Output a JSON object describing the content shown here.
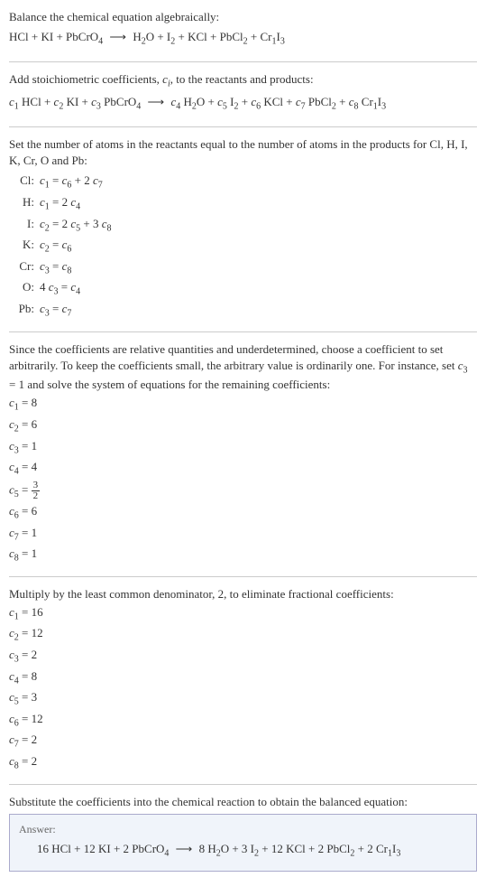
{
  "section1": {
    "intro": "Balance the chemical equation algebraically:",
    "equation_lhs": "HCl + KI + PbCrO",
    "equation_lhs_sub": "4",
    "arrow": "⟶",
    "equation_rhs": "H₂O + I₂ + KCl + PbCl₂ + Cr₁I₃"
  },
  "section2": {
    "intro_a": "Add stoichiometric coefficients, ",
    "ci": "c",
    "ci_sub": "i",
    "intro_b": ", to the reactants and products:",
    "eq": "c₁ HCl + c₂ KI + c₃ PbCrO₄  ⟶  c₄ H₂O + c₅ I₂ + c₆ KCl + c₇ PbCl₂ + c₈ Cr₁I₃"
  },
  "section3": {
    "intro": "Set the number of atoms in the reactants equal to the number of atoms in the products for Cl, H, I, K, Cr, O and Pb:",
    "rows": [
      {
        "label": "Cl:",
        "eq": "c₁ = c₆ + 2 c₇"
      },
      {
        "label": "H:",
        "eq": "c₁ = 2 c₄"
      },
      {
        "label": "I:",
        "eq": "c₂ = 2 c₅ + 3 c₈"
      },
      {
        "label": "K:",
        "eq": "c₂ = c₆"
      },
      {
        "label": "Cr:",
        "eq": "c₃ = c₈"
      },
      {
        "label": "O:",
        "eq": "4 c₃ = c₄"
      },
      {
        "label": "Pb:",
        "eq": "c₃ = c₇"
      }
    ]
  },
  "section4": {
    "intro": "Since the coefficients are relative quantities and underdetermined, choose a coefficient to set arbitrarily. To keep the coefficients small, the arbitrary value is ordinarily one. For instance, set c₃ = 1 and solve the system of equations for the remaining coefficients:",
    "coeffs": [
      "c₁ = 8",
      "c₂ = 6",
      "c₃ = 1",
      "c₄ = 4"
    ],
    "c5_label": "c₅ = ",
    "c5_num": "3",
    "c5_den": "2",
    "coeffs_after": [
      "c₆ = 6",
      "c₇ = 1",
      "c₈ = 1"
    ]
  },
  "section5": {
    "intro": "Multiply by the least common denominator, 2, to eliminate fractional coefficients:",
    "coeffs": [
      "c₁ = 16",
      "c₂ = 12",
      "c₃ = 2",
      "c₄ = 8",
      "c₅ = 3",
      "c₆ = 12",
      "c₇ = 2",
      "c₈ = 2"
    ]
  },
  "section6": {
    "intro": "Substitute the coefficients into the chemical reaction to obtain the balanced equation:",
    "answer_label": "Answer:",
    "answer_eq": "16 HCl + 12 KI + 2 PbCrO₄  ⟶  8 H₂O + 3 I₂ + 12 KCl + 2 PbCl₂ + 2 Cr₁I₃"
  }
}
